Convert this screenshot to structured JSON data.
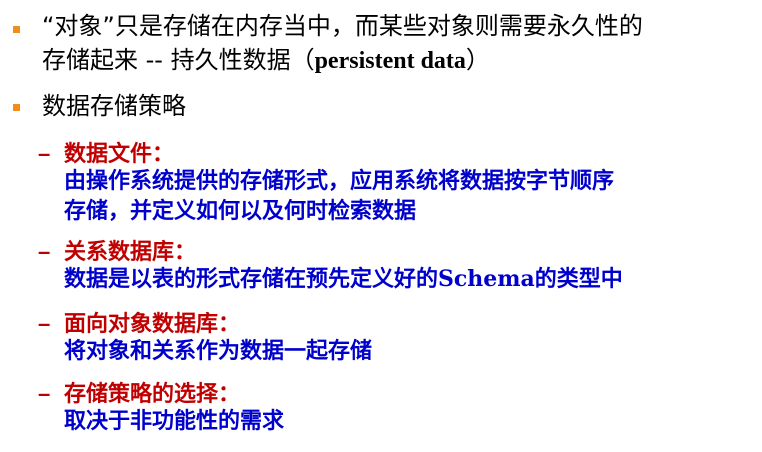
{
  "bullet1": {
    "line1": "“对象”只是存储在内存当中，而某些对象则需要永久性的",
    "line2_prefix": "存储起来 -- 持久性数据（",
    "line2_latin": "persistent data",
    "line2_suffix": "）"
  },
  "bullet2": {
    "title": "数据存储策略"
  },
  "strategies": [
    {
      "dash": "–",
      "title": "数据文件：",
      "desc": [
        "由操作系统提供的存储形式，应用系统将数据按字节顺序",
        "存储，并定义如何以及何时检索数据"
      ]
    },
    {
      "dash": "–",
      "title": "关系数据库：",
      "desc": [
        "数据是以表的形式存储在预先定义好的Schema的类型中"
      ]
    },
    {
      "dash": "–",
      "title": "面向对象数据库：",
      "desc": [
        "将对象和关系作为数据一起存储"
      ]
    },
    {
      "dash": "–",
      "title": "存储策略的选择：",
      "desc": [
        "取决于非功能性的需求"
      ]
    }
  ],
  "colors": {
    "bullet": "#f28c1a",
    "title_red": "#c00000",
    "desc_blue": "#0000cc",
    "text_black": "#000000"
  }
}
